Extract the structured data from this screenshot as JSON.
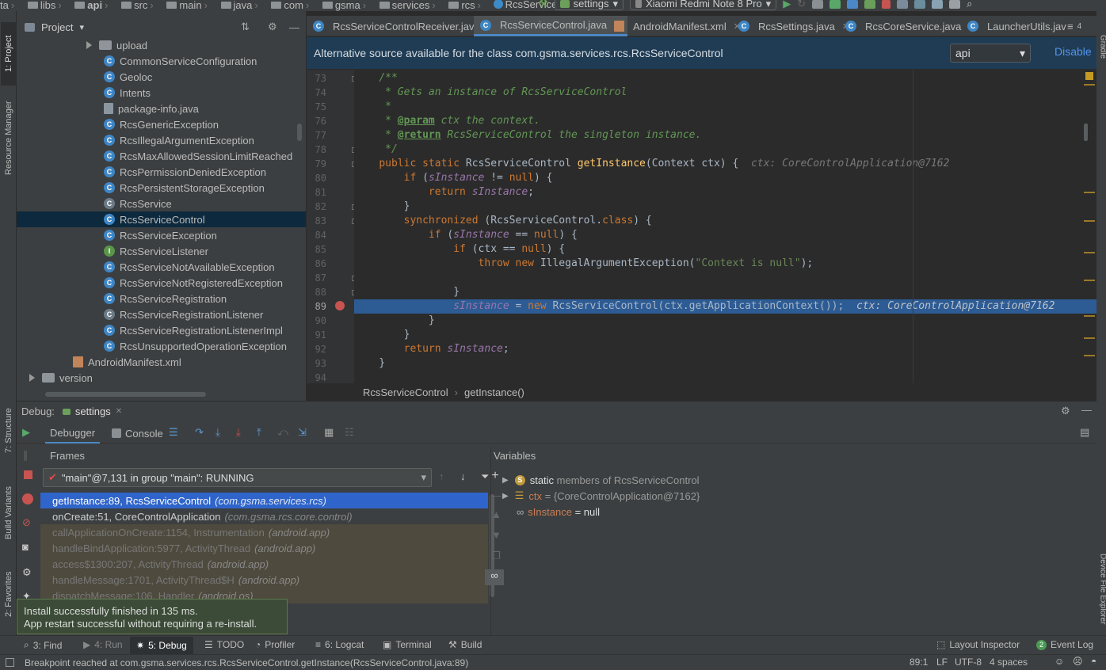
{
  "navbar": {
    "crumbs": [
      "ta",
      "libs",
      "api",
      "src",
      "main",
      "java",
      "com",
      "gsma",
      "services",
      "rcs",
      "RcsServiceControl"
    ],
    "run_config": "settings",
    "device": "Xiaomi Redmi Note 8 Pro"
  },
  "left_strip": {
    "project_tab": "1: Project",
    "resource_manager_tab": "Resource Manager",
    "structure_tab": "7: Structure",
    "build_variants_tab": "Build Variants",
    "favorites_tab": "2: Favorites"
  },
  "right_strip": {
    "gradle_tab": "Gradle",
    "device_file_tab": "Device File Explorer"
  },
  "project": {
    "title": "Project",
    "items": [
      {
        "label": "upload",
        "kind": "folder"
      },
      {
        "label": "CommonServiceConfiguration",
        "kind": "class"
      },
      {
        "label": "Geoloc",
        "kind": "class"
      },
      {
        "label": "Intents",
        "kind": "class"
      },
      {
        "label": "package-info.java",
        "kind": "file"
      },
      {
        "label": "RcsGenericException",
        "kind": "class"
      },
      {
        "label": "RcsIllegalArgumentException",
        "kind": "class"
      },
      {
        "label": "RcsMaxAllowedSessionLimitReached",
        "kind": "class"
      },
      {
        "label": "RcsPermissionDeniedException",
        "kind": "class"
      },
      {
        "label": "RcsPersistentStorageException",
        "kind": "class"
      },
      {
        "label": "RcsService",
        "kind": "abstract"
      },
      {
        "label": "RcsServiceControl",
        "kind": "class",
        "selected": true
      },
      {
        "label": "RcsServiceException",
        "kind": "class"
      },
      {
        "label": "RcsServiceListener",
        "kind": "interface"
      },
      {
        "label": "RcsServiceNotAvailableException",
        "kind": "class"
      },
      {
        "label": "RcsServiceNotRegisteredException",
        "kind": "class"
      },
      {
        "label": "RcsServiceRegistration",
        "kind": "class"
      },
      {
        "label": "RcsServiceRegistrationListener",
        "kind": "abstract"
      },
      {
        "label": "RcsServiceRegistrationListenerImpl",
        "kind": "class"
      },
      {
        "label": "RcsUnsupportedOperationException",
        "kind": "class"
      },
      {
        "label": "AndroidManifest.xml",
        "kind": "xml"
      },
      {
        "label": "version",
        "kind": "folder-collapsed"
      }
    ]
  },
  "editor": {
    "tabs": [
      {
        "label": "RcsServiceControlReceiver.java"
      },
      {
        "label": "RcsServiceControl.java",
        "active": true
      },
      {
        "label": "AndroidManifest.xml"
      },
      {
        "label": "RcsSettings.java"
      },
      {
        "label": "RcsCoreService.java"
      },
      {
        "label": "LauncherUtils.jav"
      }
    ],
    "tab_overflow": "4",
    "alt_source_message": "Alternative source available for the class com.gsma.services.rcs.RcsServiceControl",
    "alt_source_select": "api",
    "disable_label": "Disable",
    "line_numbers": [
      "73",
      "74",
      "75",
      "76",
      "77",
      "78",
      "79",
      "80",
      "81",
      "82",
      "83",
      "84",
      "85",
      "86",
      "87",
      "88",
      "89",
      "90",
      "91",
      "92",
      "93",
      "94"
    ],
    "breadcrumb": [
      "RcsServiceControl",
      "getInstance()"
    ],
    "current_line": "89"
  },
  "debug": {
    "label": "Debug:",
    "session": "settings",
    "debugger_tab": "Debugger",
    "console_tab": "Console",
    "frames_title": "Frames",
    "variables_title": "Variables",
    "thread": "\"main\"@7,131 in group \"main\": RUNNING",
    "frames": [
      {
        "method": "getInstance:89, RcsServiceControl",
        "pkg": "(com.gsma.services.rcs)",
        "state": "sel"
      },
      {
        "method": "onCreate:51, CoreControlApplication",
        "pkg": "(com.gsma.rcs.core.control)",
        "state": "norm"
      },
      {
        "method": "callApplicationOnCreate:1154, Instrumentation",
        "pkg": "(android.app)",
        "state": "lib"
      },
      {
        "method": "handleBindApplication:5977, ActivityThread",
        "pkg": "(android.app)",
        "state": "lib"
      },
      {
        "method": "access$1300:207, ActivityThread",
        "pkg": "(android.app)",
        "state": "lib"
      },
      {
        "method": "handleMessage:1701, ActivityThread$H",
        "pkg": "(android.app)",
        "state": "lib"
      },
      {
        "method": "dispatchMessage:106, Handler",
        "pkg": "(android.os)",
        "state": "lib"
      }
    ],
    "variables": [
      {
        "name": "static",
        "value": "members of RcsServiceControl"
      },
      {
        "name": "ctx",
        "value": "= {CoreControlApplication@7162}"
      },
      {
        "name": "sInstance",
        "value": "= null"
      }
    ]
  },
  "toast": {
    "line1": "Install successfully finished in 135 ms.",
    "line2": "App restart successful without requiring a re-install."
  },
  "tool_windows": {
    "find": "3: Find",
    "run": "4: Run",
    "debug": "5: Debug",
    "todo": "TODO",
    "profiler": "Profiler",
    "logcat": "6: Logcat",
    "terminal": "Terminal",
    "build": "Build",
    "layout_inspector": "Layout Inspector",
    "event_log": "Event Log",
    "event_count": "2"
  },
  "status": {
    "message": "Breakpoint reached at com.gsma.services.rcs.RcsServiceControl.getInstance(RcsServiceControl.java:89)",
    "position": "89:1",
    "line_sep": "LF",
    "encoding": "UTF-8",
    "indent": "4 spaces"
  },
  "colors": {
    "accent": "#2f65ca",
    "selected_line": "#2d5b94",
    "banner": "#1f3c54",
    "toast": "#3b4b37"
  }
}
